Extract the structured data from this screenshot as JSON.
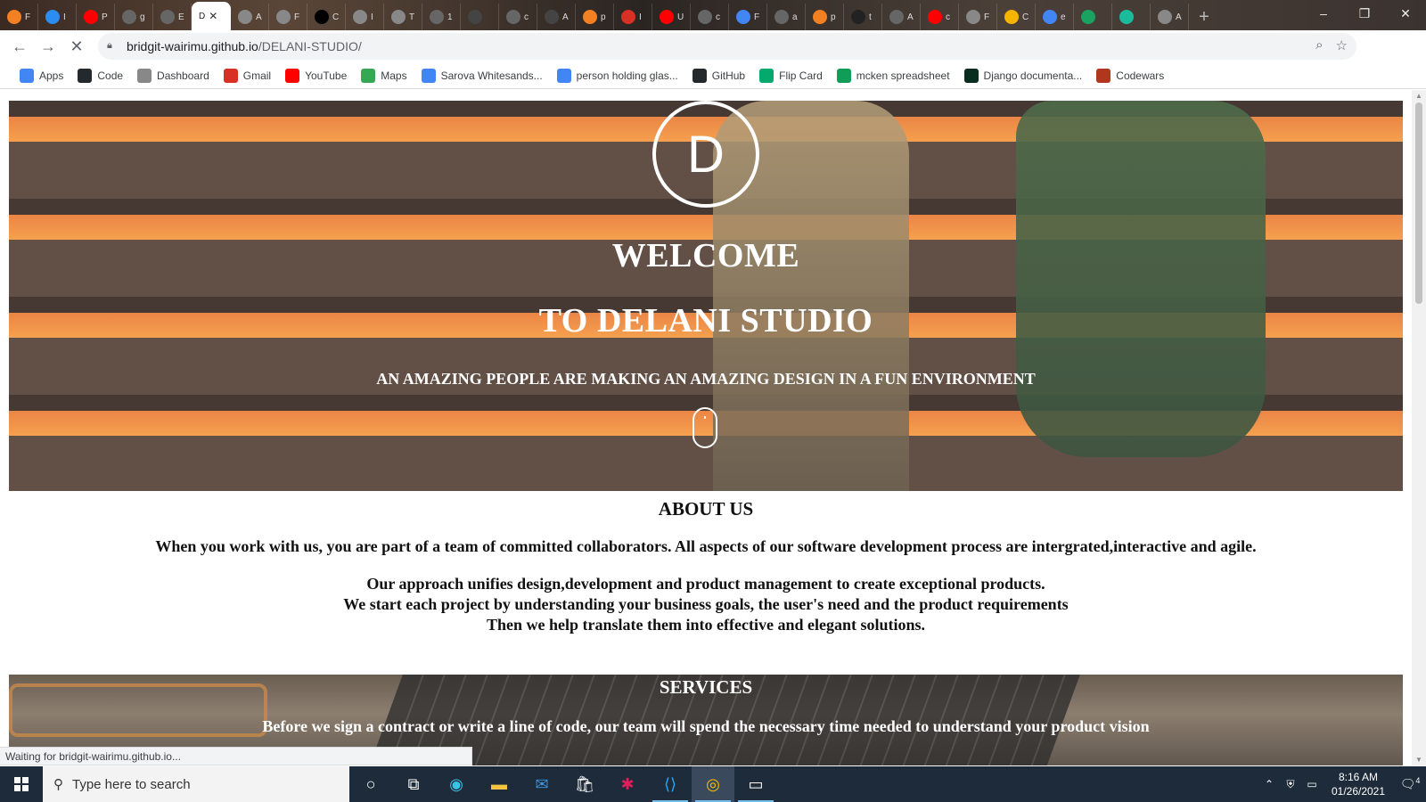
{
  "browser": {
    "tabs": [
      {
        "label": "F",
        "icon": "stackoverflow-icon",
        "color": "#f48024"
      },
      {
        "label": "I",
        "icon": "typora-icon",
        "color": "#2d8cf0"
      },
      {
        "label": "P",
        "icon": "youtube-icon",
        "color": "#ff0000"
      },
      {
        "label": "g",
        "icon": "github-icon",
        "color": "#666666"
      },
      {
        "label": "E",
        "icon": "github-icon",
        "color": "#666666"
      },
      {
        "label": "D",
        "icon": "page-icon",
        "color": "#ffffff",
        "active": true
      },
      {
        "label": "A",
        "icon": "globe-icon",
        "color": "#888888"
      },
      {
        "label": "F",
        "icon": "globe-icon",
        "color": "#888888"
      },
      {
        "label": "C",
        "icon": "a-icon",
        "color": "#000000"
      },
      {
        "label": "I",
        "icon": "globe-icon",
        "color": "#888888"
      },
      {
        "label": "T",
        "icon": "globe-icon",
        "color": "#888888"
      },
      {
        "label": "1",
        "icon": "palm-icon",
        "color": "#666666"
      },
      {
        "label": "",
        "icon": "blank-icon",
        "color": "#444444"
      },
      {
        "label": "c",
        "icon": "github-icon",
        "color": "#666666"
      },
      {
        "label": "A",
        "icon": "w-icon",
        "color": "#444444"
      },
      {
        "label": "p",
        "icon": "stackoverflow-icon",
        "color": "#f48024"
      },
      {
        "label": "I",
        "icon": "gmail-icon",
        "color": "#d93025"
      },
      {
        "label": "U",
        "icon": "youtube-icon",
        "color": "#ff0000"
      },
      {
        "label": "c",
        "icon": "github-icon",
        "color": "#666666"
      },
      {
        "label": "F",
        "icon": "google-icon",
        "color": "#4285f4"
      },
      {
        "label": "a",
        "icon": "github-icon",
        "color": "#666666"
      },
      {
        "label": "p",
        "icon": "stackoverflow-icon",
        "color": "#f48024"
      },
      {
        "label": "t",
        "icon": "toolbox-icon",
        "color": "#222222"
      },
      {
        "label": "A",
        "icon": "github-icon",
        "color": "#666666"
      },
      {
        "label": "c",
        "icon": "youtube-icon",
        "color": "#ff0000"
      },
      {
        "label": "F",
        "icon": "globe-icon",
        "color": "#888888"
      },
      {
        "label": "C",
        "icon": "slides-icon",
        "color": "#f4b400"
      },
      {
        "label": "e",
        "icon": "google-icon",
        "color": "#4285f4"
      },
      {
        "label": "",
        "icon": "chart-icon",
        "color": "#1aa260"
      },
      {
        "label": "",
        "icon": "leaf-icon",
        "color": "#1abc9c"
      },
      {
        "label": "A",
        "icon": "globe-icon",
        "color": "#888888"
      }
    ],
    "new_tab": "+",
    "window_controls": {
      "minimize": "–",
      "restore": "❐",
      "close": "✕"
    },
    "address": {
      "host": "bridgit-wairimu.github.io",
      "path": "/DELANI-STUDIO/"
    },
    "bookmarks": [
      {
        "label": "Apps",
        "icon": "apps-grid-icon",
        "color": "#4285f4"
      },
      {
        "label": "Code",
        "icon": "github-icon",
        "color": "#24292e"
      },
      {
        "label": "Dashboard",
        "icon": "palm-icon",
        "color": "#888888"
      },
      {
        "label": "Gmail",
        "icon": "gmail-icon",
        "color": "#d93025"
      },
      {
        "label": "YouTube",
        "icon": "youtube-icon",
        "color": "#ff0000"
      },
      {
        "label": "Maps",
        "icon": "maps-pin-icon",
        "color": "#34a853"
      },
      {
        "label": "Sarova Whitesands...",
        "icon": "google-icon",
        "color": "#4285f4"
      },
      {
        "label": "person holding glas...",
        "icon": "google-icon",
        "color": "#4285f4"
      },
      {
        "label": "GitHub",
        "icon": "github-icon",
        "color": "#24292e"
      },
      {
        "label": "Flip Card",
        "icon": "w3-icon",
        "color": "#04aa6d"
      },
      {
        "label": "mcken spreadsheet",
        "icon": "sheets-icon",
        "color": "#0f9d58"
      },
      {
        "label": "Django documenta...",
        "icon": "django-icon",
        "color": "#092e20"
      },
      {
        "label": "Codewars",
        "icon": "codewars-icon",
        "color": "#b1361e"
      }
    ],
    "status_text": "Waiting for bridgit-wairimu.github.io..."
  },
  "page": {
    "logo_letter": "D",
    "welcome_line1": "WELCOME",
    "welcome_line2": "TO DELANI STUDIO",
    "tagline": "AN AMAZING PEOPLE ARE MAKING AN AMAZING DESIGN IN A FUN ENVIRONMENT",
    "about": {
      "heading": "ABOUT US",
      "para1": "When you work with us, you are part of a team of committed collaborators. All aspects of our software development process are intergrated,interactive and agile.",
      "para2_line1": "Our approach unifies design,development and product management to create exceptional products.",
      "para2_line2": "We start each project by understanding your business goals, the user's need and the product requirements",
      "para2_line3": "Then we help translate them into effective and elegant solutions."
    },
    "services": {
      "heading": "SERVICES",
      "text": "Before we sign a contract or write a line of code, our team will spend the necessary time needed to understand your product vision"
    }
  },
  "taskbar": {
    "search_placeholder": "Type here to search",
    "time": "8:16 AM",
    "date": "01/26/2021",
    "notification_count": "4"
  }
}
